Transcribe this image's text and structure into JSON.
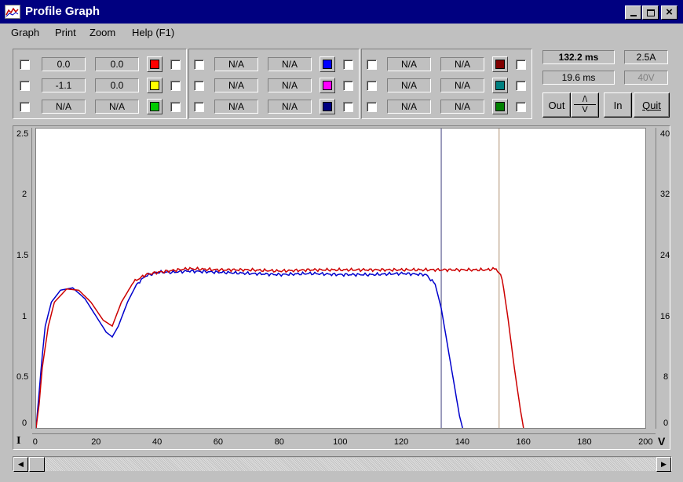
{
  "window": {
    "title": "Profile Graph",
    "minimize": "_",
    "maximize": "□",
    "close": "×"
  },
  "menu": [
    {
      "label": "Graph"
    },
    {
      "label": "Print"
    },
    {
      "label": "Zoom"
    },
    {
      "label": "Help (F1)"
    }
  ],
  "channels": {
    "group1": {
      "rows": [
        {
          "v1": "0.0",
          "v2": "0.0",
          "color": "#ff0000"
        },
        {
          "v1": "-1.1",
          "v2": "0.0",
          "color": "#ffff00"
        },
        {
          "v1": "N/A",
          "v2": "N/A",
          "color": "#00cc00"
        }
      ]
    },
    "group2": {
      "rows": [
        {
          "v1": "N/A",
          "v2": "N/A",
          "color": "#0000ff"
        },
        {
          "v1": "N/A",
          "v2": "N/A",
          "color": "#ff00ff"
        },
        {
          "v1": "N/A",
          "v2": "N/A",
          "color": "#000080"
        }
      ]
    },
    "group3": {
      "rows": [
        {
          "v1": "N/A",
          "v2": "N/A",
          "color": "#800000"
        },
        {
          "v1": "N/A",
          "v2": "N/A",
          "color": "#008080"
        },
        {
          "v1": "N/A",
          "v2": "N/A",
          "color": "#008000"
        }
      ]
    }
  },
  "status": {
    "time_primary": "132.2 ms",
    "current": "2.5A",
    "time_secondary": "19.6 ms",
    "voltage": "40V"
  },
  "buttons": {
    "out": "Out",
    "up": "/\\",
    "down": "V",
    "in": "In",
    "quit": "Quit"
  },
  "axes": {
    "left_label": "I",
    "right_label": "V",
    "left_ticks": [
      "2.5",
      "2",
      "1.5",
      "1",
      "0.5",
      "0"
    ],
    "right_ticks": [
      "40",
      "32",
      "24",
      "16",
      "8",
      "0"
    ],
    "x_ticks": [
      "0",
      "20",
      "40",
      "60",
      "80",
      "100",
      "120",
      "140",
      "160",
      "180",
      "200"
    ]
  },
  "chart_data": {
    "type": "line",
    "xlabel": "",
    "ylabel": "",
    "xlim": [
      0,
      200
    ],
    "ylim": [
      0,
      2.5
    ],
    "y2lim": [
      0,
      40
    ],
    "grid": false,
    "series": [
      {
        "color": "#0000cc",
        "x": [
          0,
          1,
          2,
          3,
          5,
          8,
          12,
          16,
          20,
          23,
          25,
          27,
          30,
          33,
          36,
          40,
          45,
          50,
          60,
          70,
          80,
          90,
          100,
          110,
          120,
          128,
          131,
          133,
          135,
          137,
          139,
          140
        ],
        "y": [
          0,
          0.3,
          0.6,
          0.85,
          1.05,
          1.15,
          1.17,
          1.08,
          0.92,
          0.8,
          0.76,
          0.85,
          1.05,
          1.2,
          1.27,
          1.3,
          1.3,
          1.31,
          1.3,
          1.29,
          1.28,
          1.29,
          1.28,
          1.28,
          1.29,
          1.28,
          1.2,
          1.0,
          0.7,
          0.4,
          0.1,
          0
        ]
      },
      {
        "color": "#cc0000",
        "x": [
          0,
          1,
          2,
          4,
          6,
          10,
          14,
          18,
          22,
          25,
          28,
          32,
          36,
          40,
          50,
          60,
          70,
          80,
          90,
          100,
          110,
          120,
          130,
          140,
          148,
          151,
          153,
          155,
          157,
          159,
          160
        ],
        "y": [
          0,
          0.2,
          0.5,
          0.85,
          1.05,
          1.16,
          1.15,
          1.05,
          0.9,
          0.85,
          1.05,
          1.22,
          1.28,
          1.3,
          1.33,
          1.32,
          1.32,
          1.31,
          1.32,
          1.32,
          1.32,
          1.32,
          1.32,
          1.32,
          1.32,
          1.33,
          1.25,
          0.9,
          0.5,
          0.15,
          0
        ]
      }
    ],
    "cursors": [
      {
        "x": 133,
        "color": "#404080"
      },
      {
        "x": 152,
        "color": "#b09070"
      }
    ]
  }
}
